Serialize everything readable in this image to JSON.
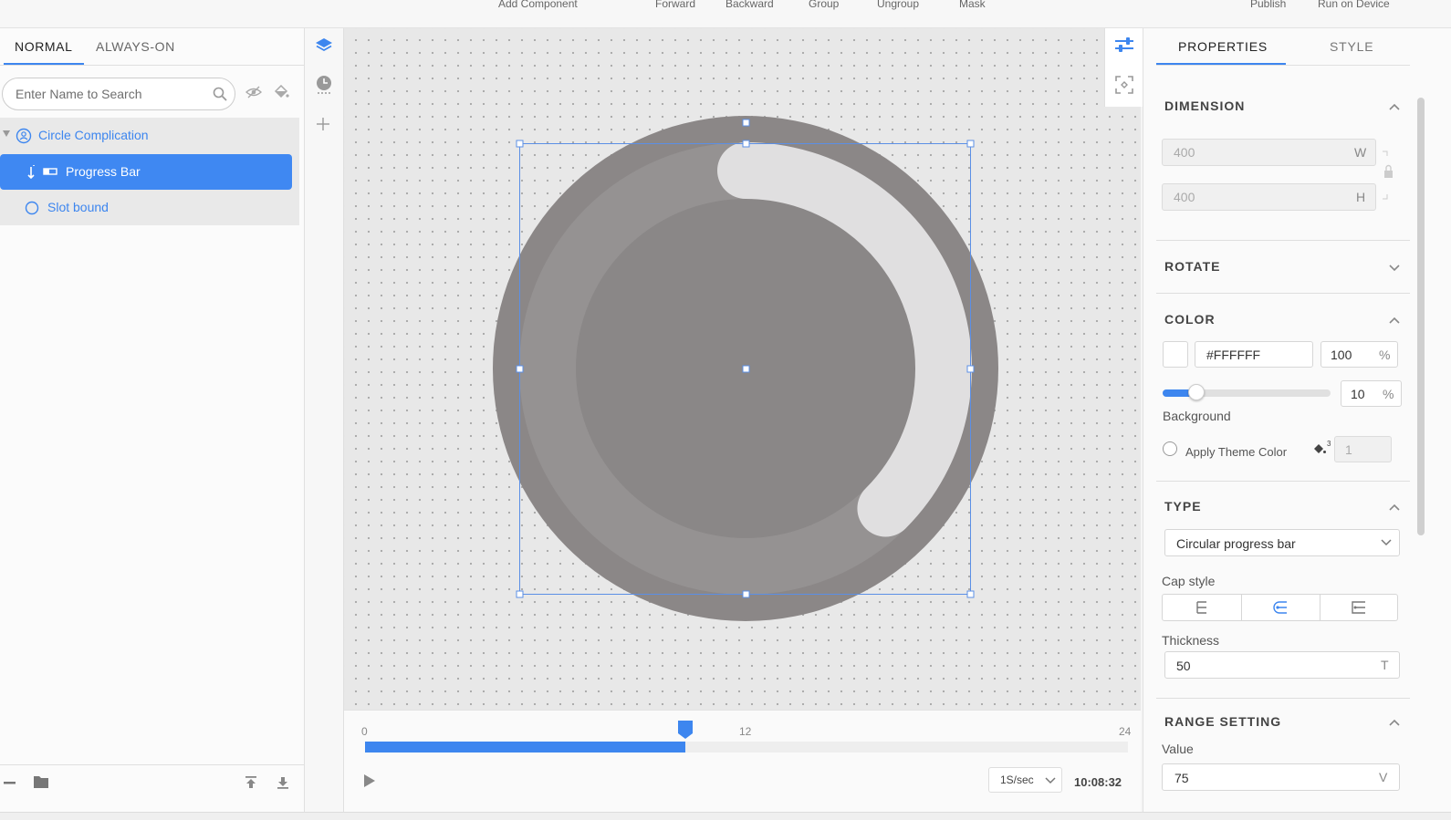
{
  "toolbar": {
    "add_component": "Add Component",
    "forward": "Forward",
    "backward": "Backward",
    "group": "Group",
    "ungroup": "Ungroup",
    "mask": "Mask",
    "publish": "Publish",
    "run_on_device": "Run on Device"
  },
  "left_panel": {
    "tabs": [
      {
        "label": "NORMAL",
        "active": true
      },
      {
        "label": "ALWAYS-ON",
        "active": false
      }
    ],
    "search_placeholder": "Enter Name to Search",
    "tree": [
      {
        "label": "Circle Complication",
        "icon": "complication-icon",
        "level": 0
      },
      {
        "label": "Progress Bar",
        "icon": "progress-bar-icon",
        "level": 1,
        "selected": true
      },
      {
        "label": "Slot bound",
        "icon": "circle-outline-icon",
        "level": 1
      }
    ]
  },
  "canvas": {
    "progress_value": 75,
    "background_opacity_percent": 10,
    "progress_color": "#FFFFFF"
  },
  "timeline": {
    "start_label": "0",
    "mid_label": "12",
    "end_label": "24",
    "position_fraction": 0.42,
    "speed": "1S/sec",
    "time": "10:08:32"
  },
  "right_panel": {
    "tabs": [
      {
        "label": "PROPERTIES",
        "active": true
      },
      {
        "label": "STYLE",
        "active": false
      }
    ],
    "dimension": {
      "title": "DIMENSION",
      "width": "400",
      "width_unit": "W",
      "height": "400",
      "height_unit": "H"
    },
    "rotate": {
      "title": "ROTATE"
    },
    "color": {
      "title": "COLOR",
      "hex": "#FFFFFF",
      "opacity": "100",
      "percent": "%",
      "bg_opacity": "10",
      "bg_opacity_fraction": 0.1,
      "background_label": "Background",
      "apply_theme_label": "Apply Theme Color",
      "theme_index": "1",
      "theme_superscript": "3"
    },
    "type": {
      "title": "TYPE",
      "selected": "Circular progress bar",
      "cap_style_label": "Cap style",
      "thickness_label": "Thickness",
      "thickness": "50",
      "thickness_unit": "T"
    },
    "range": {
      "title": "RANGE SETTING",
      "value_label": "Value",
      "value": "75",
      "value_unit": "V"
    }
  },
  "colors": {
    "accent": "#3d86ef",
    "dial_outer": "#8b8787",
    "dial_ring": "#959292",
    "dial_inner": "#8a8787",
    "progress": "#e0dfe0"
  }
}
